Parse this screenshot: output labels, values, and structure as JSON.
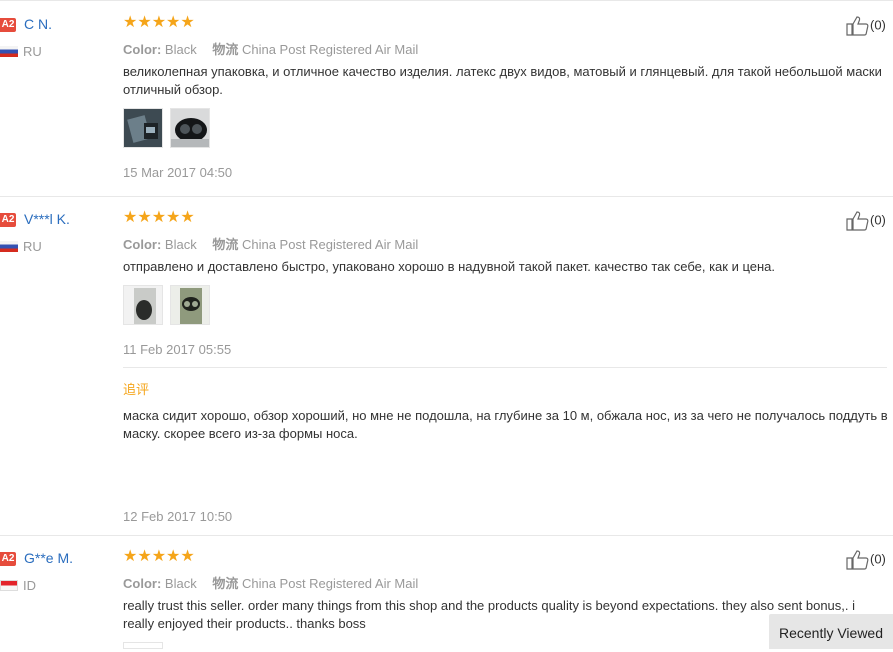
{
  "reviews": [
    {
      "level": "A2",
      "name": "C N.",
      "country": "RU",
      "rating": 5,
      "color_label": "Color:",
      "color_value": "Black",
      "ship_label": "物流",
      "ship_value": "China Post Registered Air Mail",
      "text": "великолепная упаковка, и отличное качество изделия. латекс двух видов, матовый и глянцевый. для такой небольшой маски отличный обзор.",
      "date": "15 Mar 2017 04:50",
      "likes": "(0)"
    },
    {
      "level": "A2",
      "name": "V***l K.",
      "country": "RU",
      "rating": 5,
      "color_label": "Color:",
      "color_value": "Black",
      "ship_label": "物流",
      "ship_value": "China Post Registered Air Mail",
      "text": "отправлено и доставлено быстро, упаковано хорошо в надувной такой пакет. качество так себе, как и цена.",
      "date": "11 Feb 2017 05:55",
      "likes": "(0)",
      "followup_title": "追评",
      "followup_text": "маска сидит хорошо, обзор хороший, но мне не подошла, на глубине за 10 м, обжала нос, из за чего не получалось поддуть в маску. скорее всего из-за формы носа.",
      "followup_date": "12 Feb 2017 10:50"
    },
    {
      "level": "A2",
      "name": "G**e M.",
      "country": "ID",
      "rating": 5,
      "color_label": "Color:",
      "color_value": "Black",
      "ship_label": "物流",
      "ship_value": "China Post Registered Air Mail",
      "text": "really trust this seller. order many things from this shop and the products quality is beyond expectations. they also sent bonus,. i really enjoyed their products.. thanks boss",
      "likes": "(0)"
    }
  ],
  "stars_glyph": "★★★★★",
  "recently_viewed": "Recently Viewed",
  "colors": {
    "accent_orange": "#f5a51a",
    "link_blue": "#2a6dbe",
    "badge_red": "#e64c3c"
  }
}
